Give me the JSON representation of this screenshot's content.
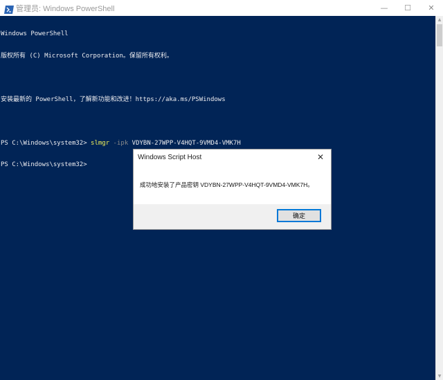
{
  "titlebar": {
    "title": "管理员: Windows PowerShell",
    "icon": "powershell-icon",
    "minimize_glyph": "—",
    "maximize_glyph": "☐",
    "close_glyph": "✕"
  },
  "console": {
    "lines": [
      "Windows PowerShell",
      "版权所有 (C) Microsoft Corporation。保留所有权利。",
      "",
      "安装最新的 PowerShell，了解新功能和改进！https://aka.ms/PSWindows",
      ""
    ],
    "command": {
      "prompt": "PS C:\\Windows\\system32> ",
      "cmdlet": "slmgr",
      "parameter": " -ipk",
      "argument": " VDYBN-27WPP-V4HQT-9VMD4-VMK7H"
    },
    "final_prompt": "PS C:\\Windows\\system32>"
  },
  "dialog": {
    "title": "Windows Script Host",
    "message": "成功地安装了产品密钥 VDYBN-27WPP-V4HQT-9VMD4-VMK7H。",
    "ok_label": "确定",
    "close_glyph": "✕"
  },
  "colors": {
    "console_background": "#012456",
    "console_text": "#eeedf0",
    "cmdlet": "#f2f25a",
    "parameter": "#8a8a8a",
    "button_focus": "#0078d7"
  }
}
